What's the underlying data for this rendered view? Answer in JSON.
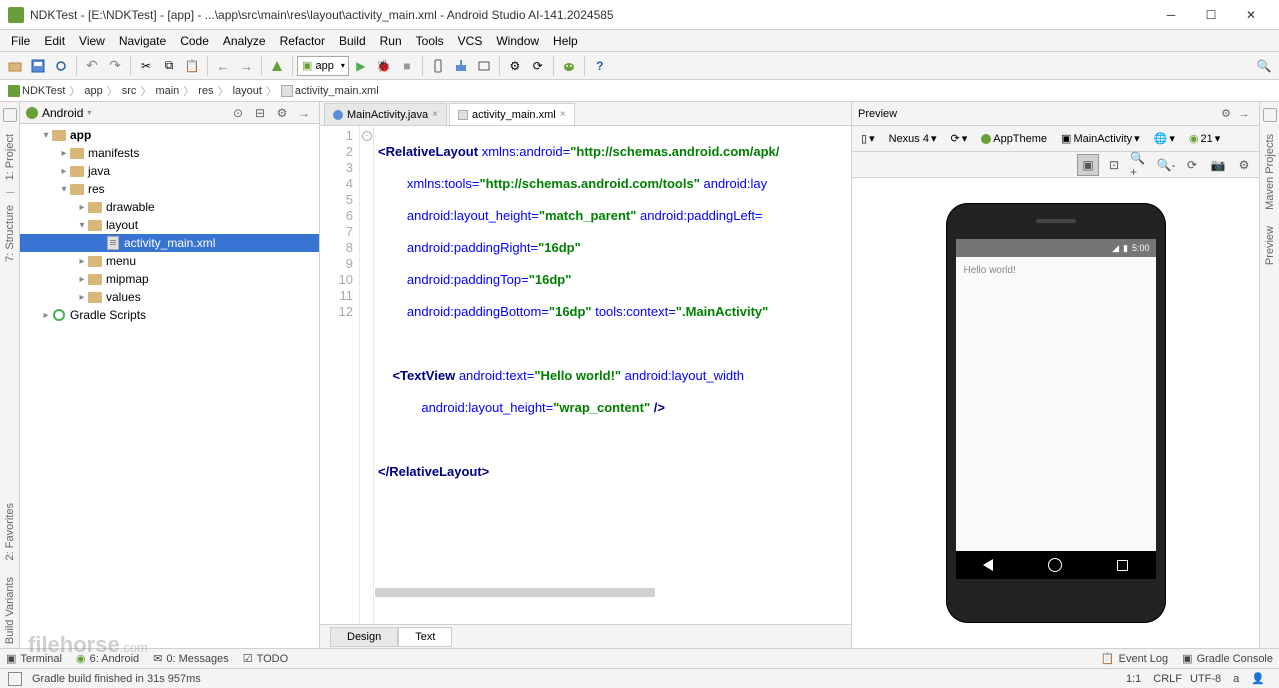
{
  "title": "NDKTest - [E:\\NDKTest] - [app] - ...\\app\\src\\main\\res\\layout\\activity_main.xml - Android Studio AI-141.2024585",
  "menu": [
    "File",
    "Edit",
    "View",
    "Navigate",
    "Code",
    "Analyze",
    "Refactor",
    "Build",
    "Run",
    "Tools",
    "VCS",
    "Window",
    "Help"
  ],
  "toolbar": {
    "module": "app"
  },
  "breadcrumb": [
    "NDKTest",
    "app",
    "src",
    "main",
    "res",
    "layout",
    "activity_main.xml"
  ],
  "project": {
    "mode": "Android",
    "tree": {
      "app": "app",
      "manifests": "manifests",
      "java": "java",
      "res": "res",
      "drawable": "drawable",
      "layout": "layout",
      "activity_main": "activity_main.xml",
      "menu": "menu",
      "mipmap": "mipmap",
      "values": "values",
      "gradle": "Gradle Scripts"
    }
  },
  "tabs": {
    "t1": "MainActivity.java",
    "t2": "activity_main.xml"
  },
  "code": {
    "l1a": "<RelativeLayout ",
    "l1b": "xmlns:android=",
    "l1c": "\"http://schemas.android.com/apk/",
    "l2a": "        xmlns:tools=",
    "l2b": "\"http://schemas.android.com/tools\"",
    "l2c": " android:lay",
    "l3a": "        android:layout_height=",
    "l3b": "\"match_parent\"",
    "l3c": " android:paddingLeft=",
    "l4a": "        android:paddingRight=",
    "l4b": "\"16dp\"",
    "l5a": "        android:paddingTop=",
    "l5b": "\"16dp\"",
    "l6a": "        android:paddingBottom=",
    "l6b": "\"16dp\"",
    "l6c": " tools:context=",
    "l6d": "\".MainActivity\"",
    "l8a": "    <TextView ",
    "l8b": "android:text=",
    "l8c": "\"Hello world!\"",
    "l8d": " android:layout_width",
    "l9a": "            android:layout_height=",
    "l9b": "\"wrap_content\"",
    "l9c": " />",
    "l11": "</RelativeLayout>"
  },
  "line_numbers": [
    "1",
    "2",
    "3",
    "4",
    "5",
    "6",
    "7",
    "8",
    "9",
    "10",
    "11",
    "12"
  ],
  "editor_bottom_tabs": {
    "design": "Design",
    "text": "Text"
  },
  "preview": {
    "title": "Preview",
    "device": "Nexus 4",
    "theme": "AppTheme",
    "activity": "MainActivity",
    "api": "21",
    "status_time": "5:00",
    "hello": "Hello world!"
  },
  "bottom": {
    "terminal": "Terminal",
    "android": "6: Android",
    "messages": "0: Messages",
    "todo": "TODO",
    "eventlog": "Event Log",
    "gradlecon": "Gradle Console"
  },
  "status": {
    "msg": "Gradle build finished in 31s 957ms",
    "pos": "1:1",
    "le": "CRLF",
    "enc": "UTF-8",
    "ctx": "a"
  },
  "left_gutter_labels": [
    "1: Project",
    "7: Structure",
    "2: Favorites",
    "Build Variants"
  ],
  "right_gutter_labels": [
    "Maven Projects",
    "Preview"
  ],
  "watermark": "filehorse",
  "watermark_tld": ".com"
}
